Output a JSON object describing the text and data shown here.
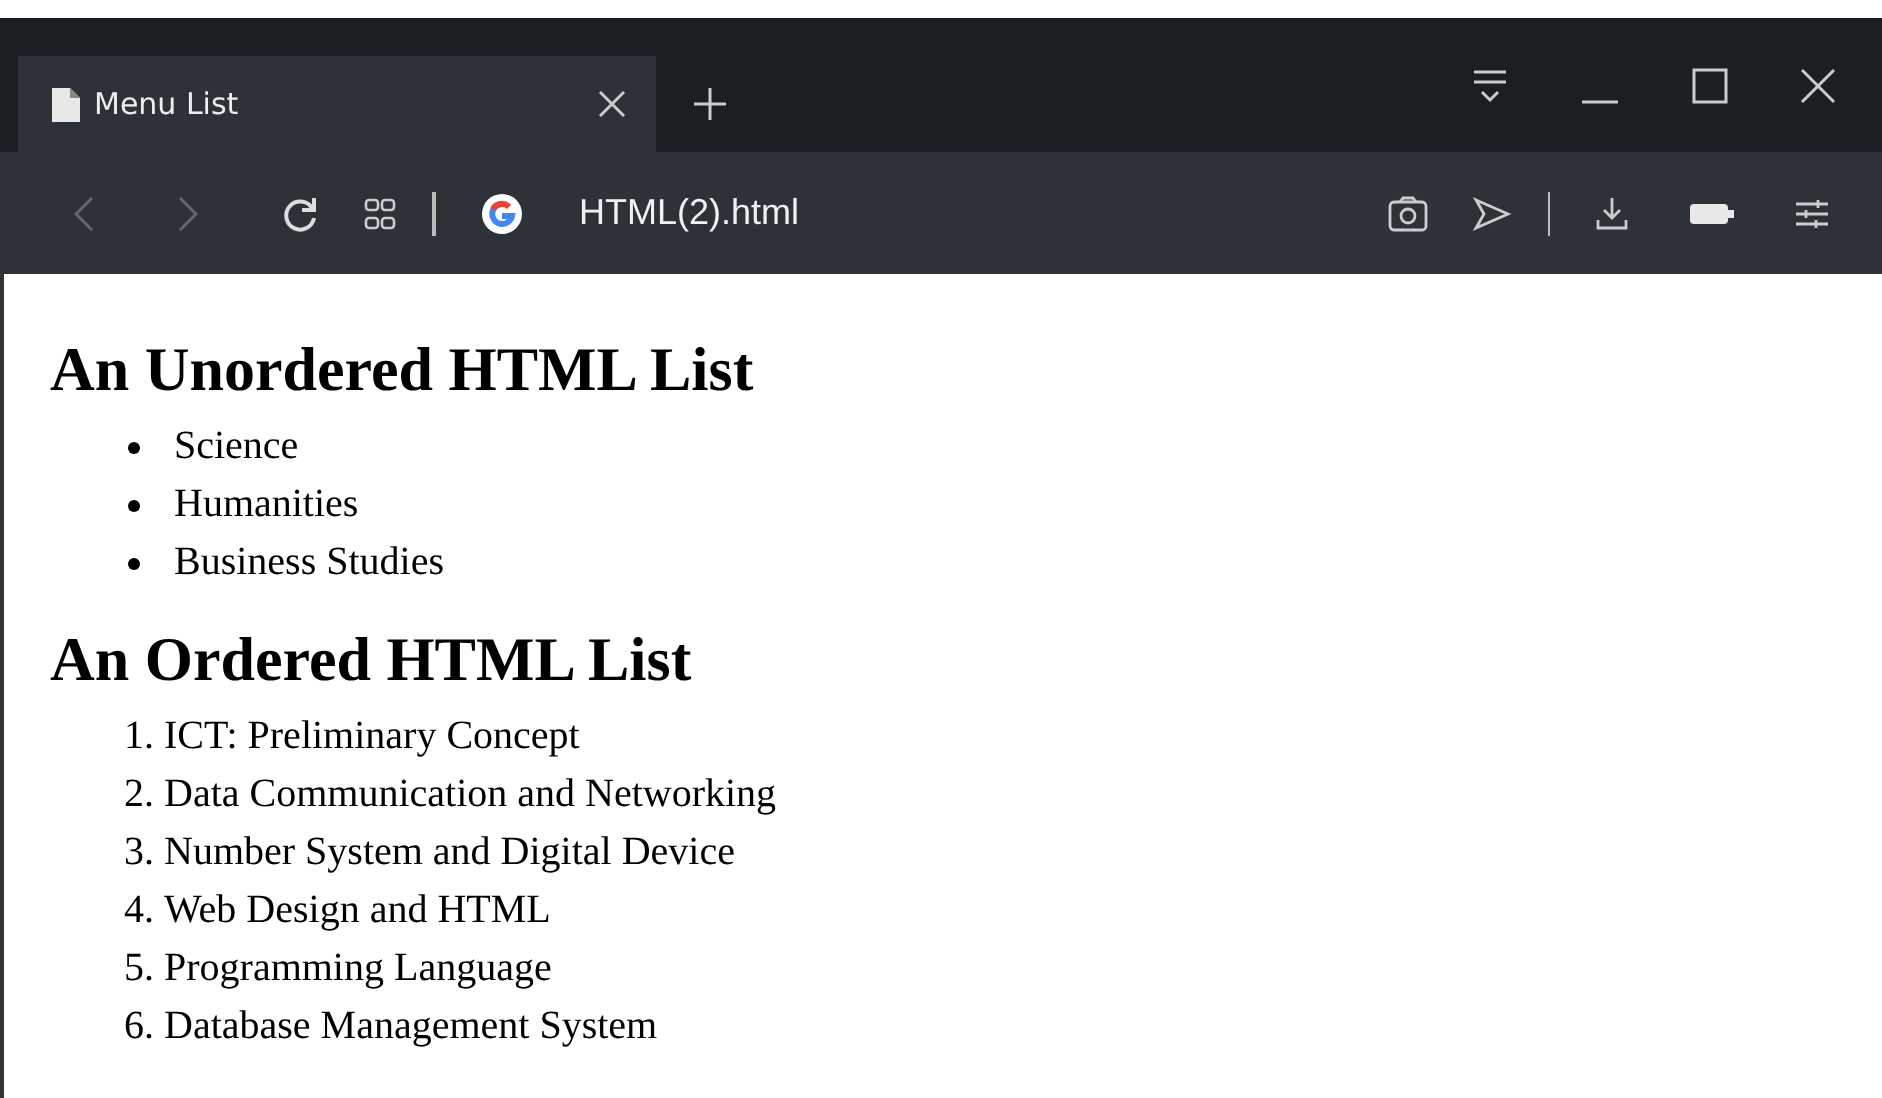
{
  "tab": {
    "title": "Menu List",
    "selected": true
  },
  "address": {
    "value": "HTML(2).html"
  },
  "page": {
    "unordered_heading": "An Unordered HTML List",
    "unordered_items": [
      "Science",
      "Humanities",
      "Business Studies"
    ],
    "ordered_heading": "An Ordered HTML List",
    "ordered_items": [
      {
        "number": "1.",
        "text": "ICT: Preliminary Concept"
      },
      {
        "number": "2.",
        "text": "Data Communication and Networking"
      },
      {
        "number": "3.",
        "text": "Number System and Digital Device"
      },
      {
        "number": "4.",
        "text": "Web Design and HTML"
      },
      {
        "number": "5.",
        "text": "Programming Language"
      },
      {
        "number": "6.",
        "text": "Database Management System"
      }
    ]
  }
}
